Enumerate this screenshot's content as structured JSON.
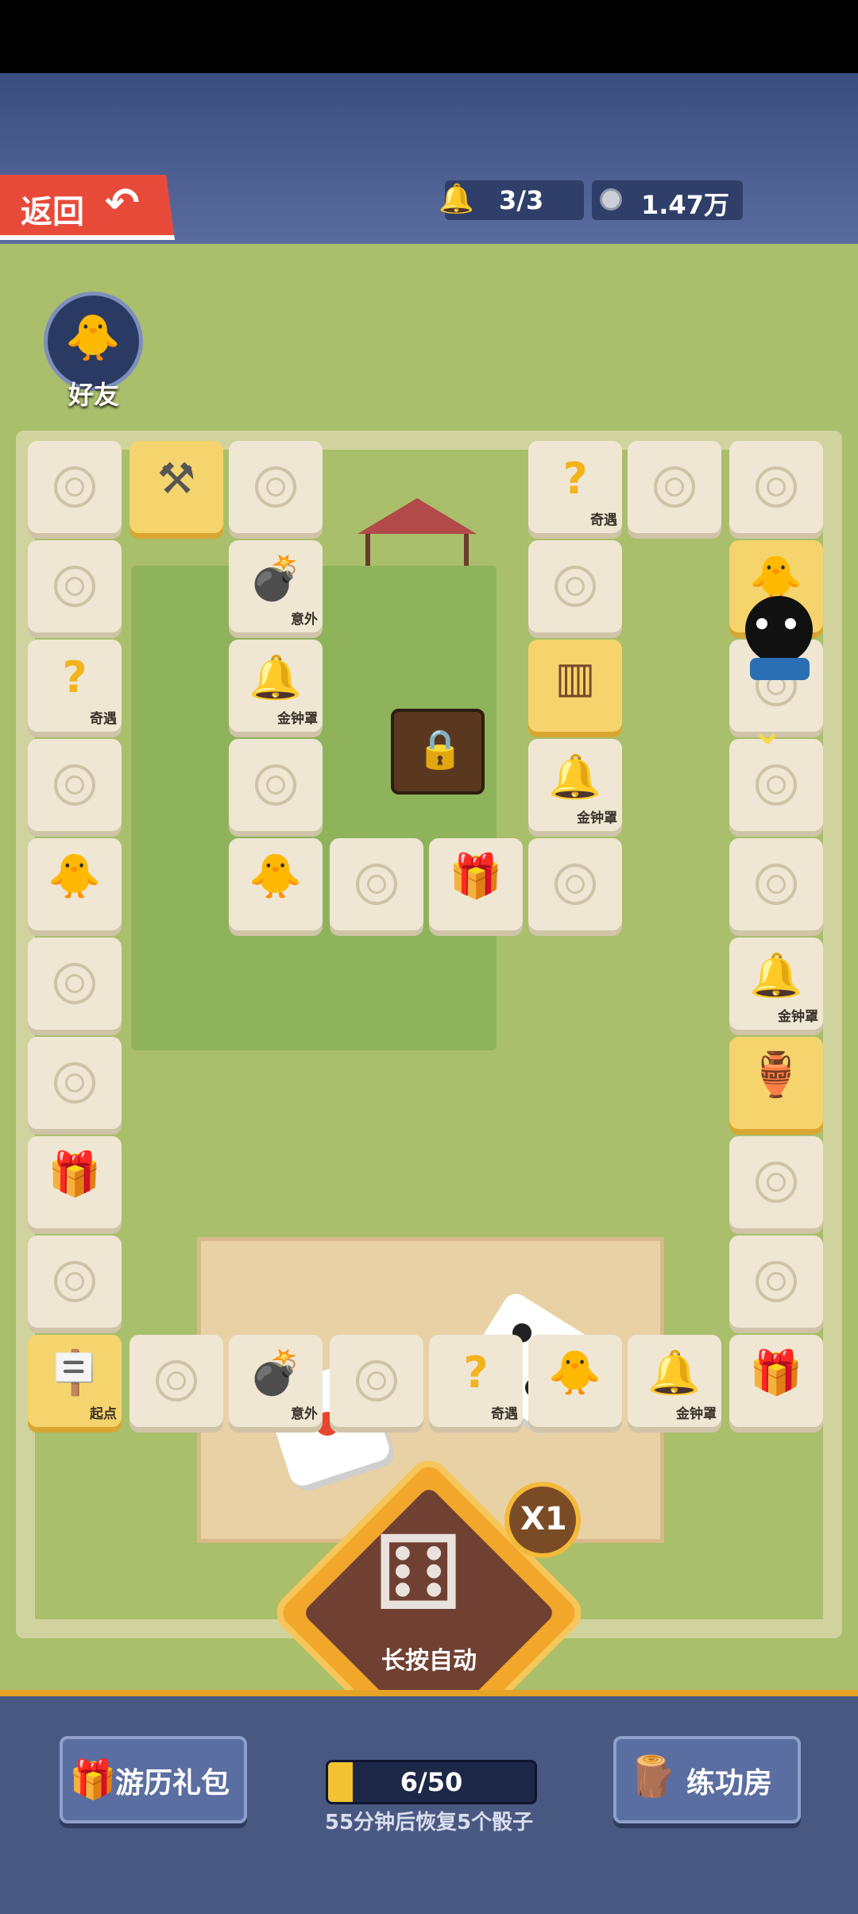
{
  "header": {
    "back_label": "返回",
    "back_icon": "undo-arrow-icon",
    "bell_count": "3/3",
    "coins": "1.47万"
  },
  "friend": {
    "label": "好友"
  },
  "tile_labels": {
    "encounter": "奇遇",
    "accident": "意外",
    "gold_bell": "金钟罩",
    "start": "起点"
  },
  "dice": {
    "left_face": 1,
    "right_face": 4
  },
  "roll": {
    "label": "长按自动",
    "multiplier": "X1"
  },
  "energy": {
    "value": "6/50",
    "current": 6,
    "max": 50,
    "recover_text": "55分钟后恢复5个骰子"
  },
  "buttons": {
    "gift": "游历礼包",
    "training": "练功房"
  },
  "colors": {
    "accent": "#e6a325",
    "back_button": "#e84a3a",
    "header": "#3a4d7e"
  }
}
